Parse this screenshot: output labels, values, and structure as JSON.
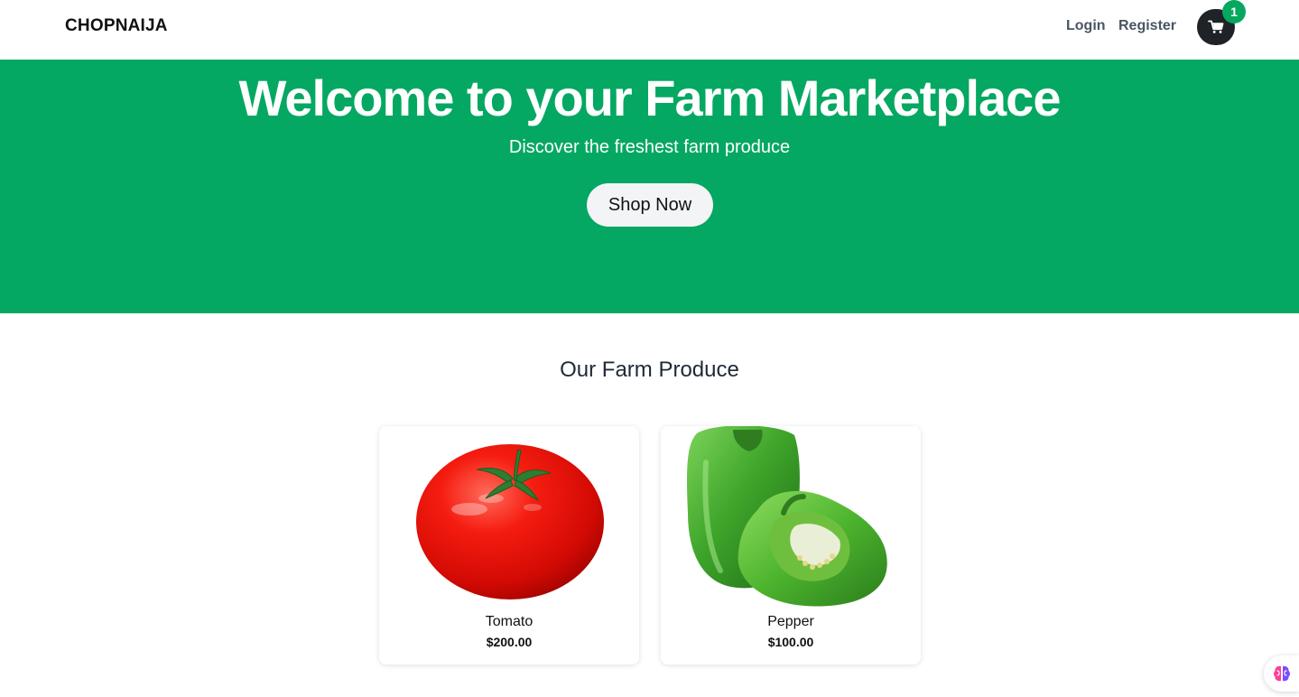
{
  "header": {
    "brand": "CHOPNAIJA",
    "nav": {
      "login": "Login",
      "register": "Register"
    },
    "cart": {
      "icon": "cart-icon",
      "count": "1"
    }
  },
  "hero": {
    "title": "Welcome to your Farm Marketplace",
    "subtitle": "Discover the freshest farm produce",
    "button_label": "Shop Now"
  },
  "products": {
    "section_title": "Our Farm Produce",
    "items": [
      {
        "name": "Tomato",
        "price": "$200.00"
      },
      {
        "name": "Pepper",
        "price": "$100.00"
      }
    ]
  },
  "widget": {
    "icon": "brain-icon"
  },
  "colors": {
    "primary_green": "#05a862",
    "badge_green": "#06a85f",
    "cart_dark": "#1f2226",
    "button_light": "#f3f4f6"
  }
}
